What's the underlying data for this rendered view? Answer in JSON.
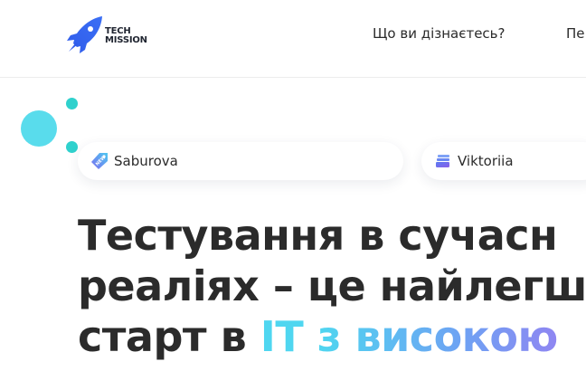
{
  "header": {
    "logo": {
      "line1": "TECH",
      "line2": "MISSION",
      "icon": "rocket-logo-icon"
    },
    "nav": [
      {
        "label": "Що ви дізнаєтесь?"
      },
      {
        "label": "Пе"
      }
    ]
  },
  "tags": [
    {
      "label": "Saburova",
      "icon": "price-tag-icon"
    },
    {
      "label": "Viktoriia",
      "icon": "stack-icon"
    }
  ],
  "hero": {
    "line1": "Тестування в сучасн",
    "line2": "реаліях – це найлегш",
    "line3_start": "старт в ",
    "line3_it": "IT",
    "line3_space": " ",
    "line3_gradient": "з високою"
  },
  "colors": {
    "accent_cyan": "#4fd6f0",
    "accent_violet": "#8f86f2",
    "logo_blue": "#2f5bea",
    "deco_cyan": "#59dcec",
    "text_dark": "#2b2b2b"
  }
}
